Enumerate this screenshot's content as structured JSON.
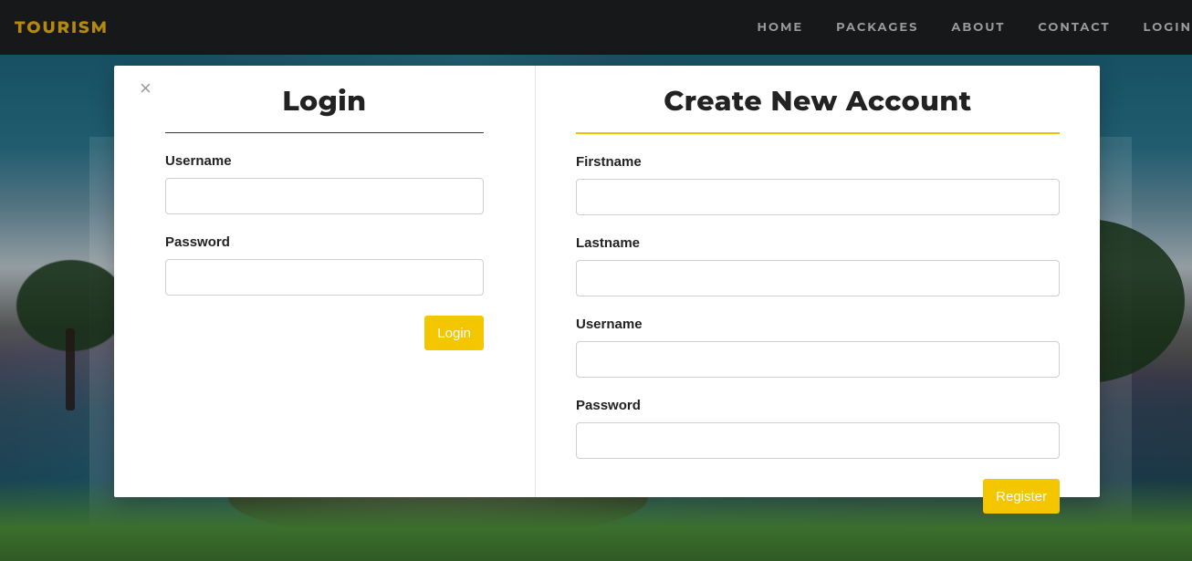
{
  "brand": "TOURISM",
  "nav": {
    "home": "HOME",
    "packages": "PACKAGES",
    "about": "ABOUT",
    "contact": "CONTACT",
    "login": "LOGIN"
  },
  "modal": {
    "close_glyph": "×",
    "login": {
      "title": "Login",
      "username_label": "Username",
      "username_value": "",
      "password_label": "Password",
      "password_value": "",
      "submit_label": "Login"
    },
    "register": {
      "title": "Create New Account",
      "firstname_label": "Firstname",
      "firstname_value": "",
      "lastname_label": "Lastname",
      "lastname_value": "",
      "username_label": "Username",
      "username_value": "",
      "password_label": "Password",
      "password_value": "",
      "submit_label": "Register"
    }
  },
  "colors": {
    "accent": "#f3c600",
    "brand_text": "#b48a0e",
    "navbar_bg": "#17181a"
  }
}
